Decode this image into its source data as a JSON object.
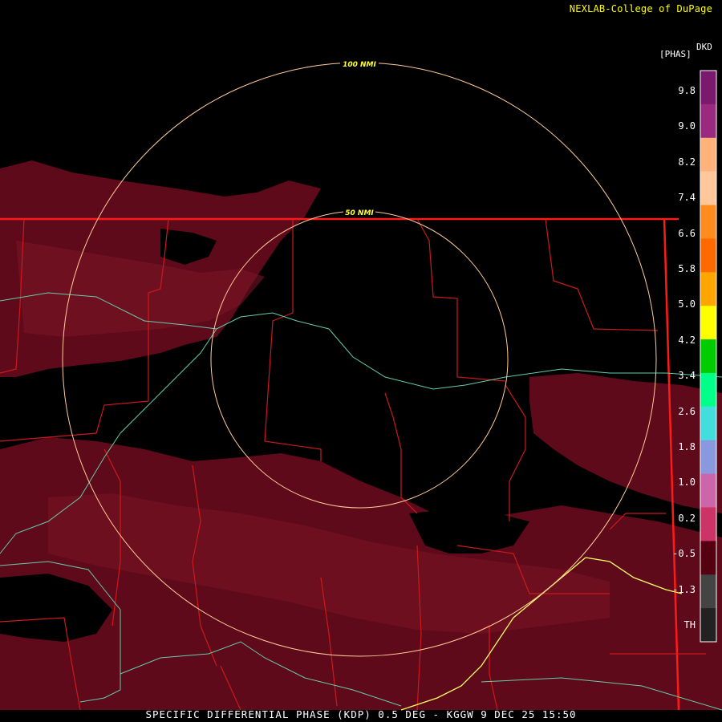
{
  "credit": "NEXLAB-College of DuPage",
  "legend": {
    "product_code": "DKD",
    "unit_label": "[PHAS]",
    "labels": [
      "9.8",
      "9.0",
      "8.2",
      "7.4",
      "6.6",
      "5.8",
      "5.0",
      "4.2",
      "3.4",
      "2.6",
      "1.8",
      "1.0",
      "0.2",
      "-0.5",
      "-1.3",
      "TH"
    ],
    "colors": [
      "#7a1a6e",
      "#9a2a80",
      "#ffb27a",
      "#ffc79a",
      "#ff8c1e",
      "#ff6a00",
      "#ffa500",
      "#ffff00",
      "#00cc00",
      "#00ff88",
      "#44dddd",
      "#8899dd",
      "#cc66aa",
      "#cc3366",
      "#550011",
      "#444444",
      "#222222"
    ]
  },
  "rings": {
    "inner_label": "50 NMI",
    "outer_label": "100 NMI"
  },
  "footer": "SPECIFIC DIFFERENTIAL PHASE (KDP) 0.5 DEG - KGGW 9 DEC 25 15:50",
  "colors": {
    "echo_dark": "#5e0a1a",
    "echo_mid": "#7a1424",
    "border_state": "#ff1a1a",
    "border_county": "#cc1a1a",
    "river": "#66ccaa",
    "road": "#ffff66",
    "ring": "#ffcc99"
  }
}
